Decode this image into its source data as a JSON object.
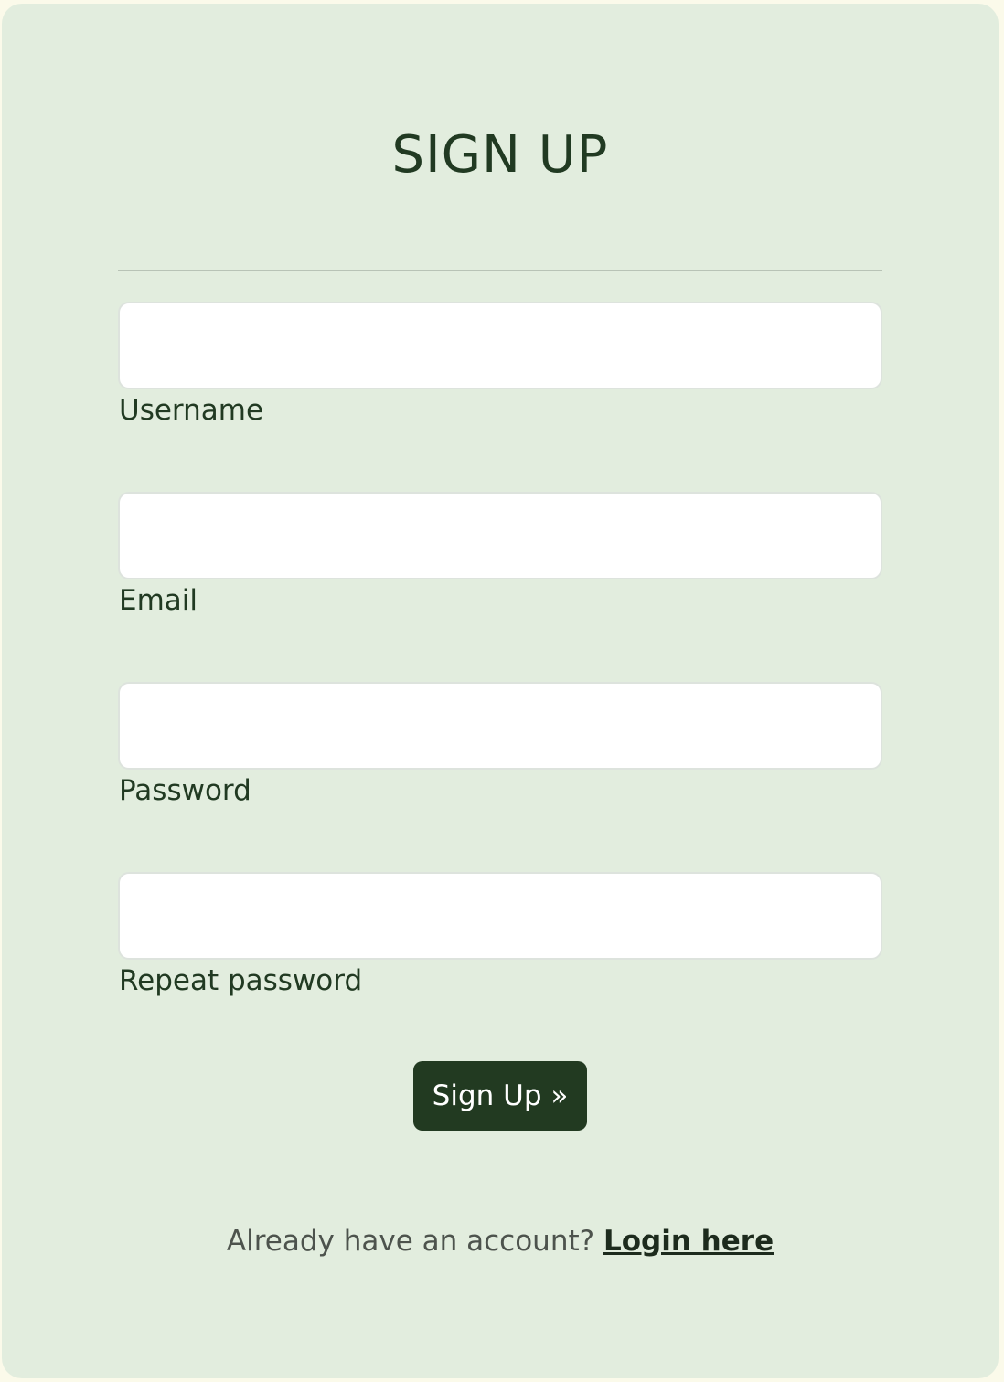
{
  "form": {
    "title": "SIGN UP",
    "fields": [
      {
        "label": "Username",
        "value": ""
      },
      {
        "label": "Email",
        "value": ""
      },
      {
        "label": "Password",
        "value": ""
      },
      {
        "label": "Repeat password",
        "value": ""
      }
    ],
    "submit_label": "Sign Up »",
    "footer_text": "Already have an account?",
    "login_link": "Login here"
  },
  "colors": {
    "page_background": "#fbfaea",
    "card_background": "#e2edde",
    "primary_dark_green": "#223a21",
    "text_green": "#213a22"
  }
}
